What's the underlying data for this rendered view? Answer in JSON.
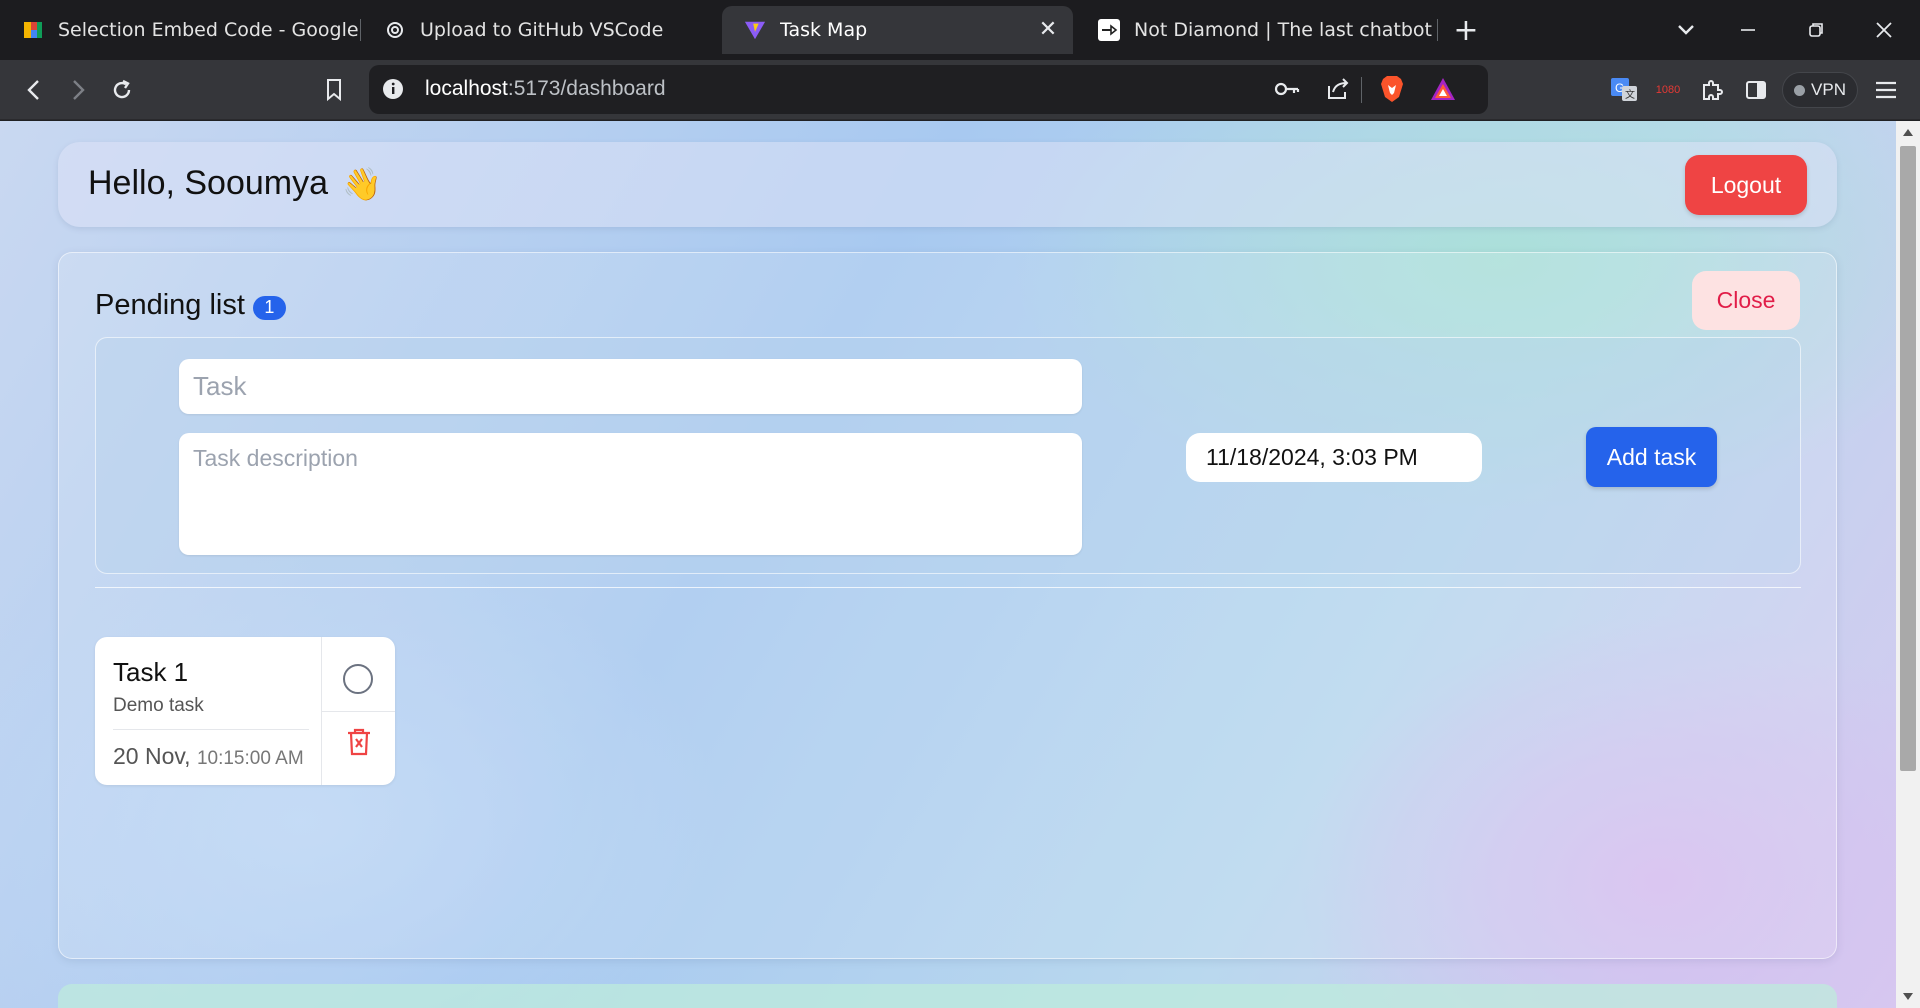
{
  "browser": {
    "tabs": [
      {
        "title": "Selection Embed Code - Google For",
        "icon": "google-forms-icon"
      },
      {
        "title": "Upload to GitHub VSCode",
        "icon": "openai-icon"
      },
      {
        "title": "Task Map",
        "icon": "vite-icon",
        "active": true
      },
      {
        "title": "Not Diamond | The last chatbot you",
        "icon": "notdiamond-icon"
      }
    ],
    "url_host": "localhost",
    "url_path": ":5173/dashboard",
    "vpn_label": "VPN",
    "extension_badge": "1080"
  },
  "header": {
    "greeting": "Hello, Sooumya",
    "wave_emoji": "👋",
    "logout_label": "Logout"
  },
  "pending": {
    "title": "Pending list",
    "count": "1",
    "close_label": "Close",
    "form": {
      "task_placeholder": "Task",
      "description_placeholder": "Task description",
      "datetime_value": "11/18/2024, 3:03 PM",
      "add_label": "Add task"
    },
    "tasks": [
      {
        "title": "Task 1",
        "description": "Demo task",
        "date": "20 Nov,",
        "time": "10:15:00 AM"
      }
    ]
  },
  "colors": {
    "accent_blue": "#2563eb",
    "logout_red": "#ef4444",
    "close_text": "#e11d48",
    "close_bg": "#fde2e2"
  }
}
